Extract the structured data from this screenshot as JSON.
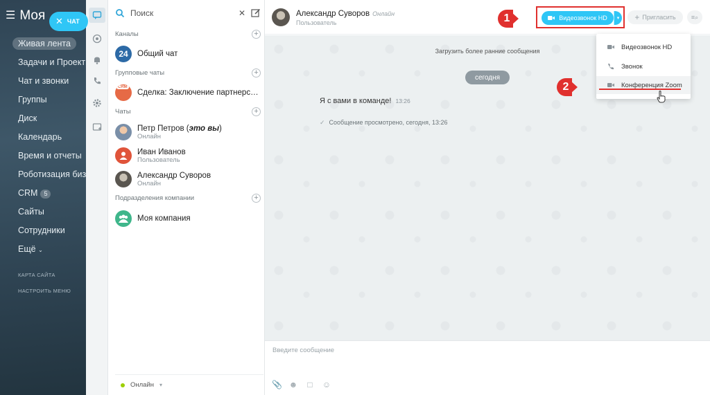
{
  "portal": {
    "title": "Моя",
    "chat_pill": "ЧАТ",
    "menu": [
      {
        "label": "Живая лента",
        "active": true
      },
      {
        "label": "Задачи и Проекты"
      },
      {
        "label": "Чат и звонки"
      },
      {
        "label": "Группы"
      },
      {
        "label": "Диск"
      },
      {
        "label": "Календарь"
      },
      {
        "label": "Время и отчеты"
      },
      {
        "label": "Роботизация бизнеса"
      },
      {
        "label": "CRM",
        "count": "5"
      },
      {
        "label": "Сайты"
      },
      {
        "label": "Сотрудники"
      },
      {
        "label": "Ещё"
      }
    ],
    "sitemap": "КАРТА САЙТА",
    "configure": "НАСТРОИТЬ МЕНЮ"
  },
  "rail_icons": [
    "chat-icon",
    "openlines-icon",
    "notifications-icon",
    "phone-icon",
    "settings-icon",
    "create-chat-icon"
  ],
  "list": {
    "search_placeholder": "Поиск",
    "sections": {
      "channels": "Каналы",
      "group_chats": "Групповые чаты",
      "chats": "Чаты",
      "departments": "Подразделения компании"
    },
    "general_chat": {
      "name": "Общий чат",
      "avatar_text": "24"
    },
    "deal_chat": {
      "name": "Сделка: Заключение партнерского договора",
      "badge": "CRM"
    },
    "contacts": [
      {
        "name": "Петр Петров",
        "suffix": "это вы",
        "status": "Онлайн",
        "avatar": "photo"
      },
      {
        "name": "Иван Иванов",
        "status": "Пользователь",
        "avatar": "default"
      },
      {
        "name": "Александр Суворов",
        "status": "Онлайн",
        "avatar": "photo-bw"
      }
    ],
    "company": {
      "name": "Моя компания"
    },
    "my_status": "Онлайн"
  },
  "chat": {
    "header": {
      "name": "Александр Суворов",
      "presence": "Онлайн",
      "role": "Пользователь"
    },
    "video_button": "Видеозвонок HD",
    "invite_button": "Пригласить",
    "load_earlier": "Загрузить более ранние сообщения",
    "date_divider": "сегодня",
    "message": {
      "text": "Я с вами в команде!",
      "time": "13:26"
    },
    "seen": "Сообщение просмотрено, сегодня, 13:26",
    "composer_placeholder": "Введите сообщение"
  },
  "dropdown": {
    "options": [
      "Видеозвонок HD",
      "Звонок",
      "Конференция Zoom"
    ],
    "highlighted": 2
  },
  "annotations": {
    "step1": "1",
    "step2": "2"
  },
  "colors": {
    "accent": "#2fc6f6",
    "annotation_red": "#e0302e",
    "online": "#9dcf00"
  }
}
